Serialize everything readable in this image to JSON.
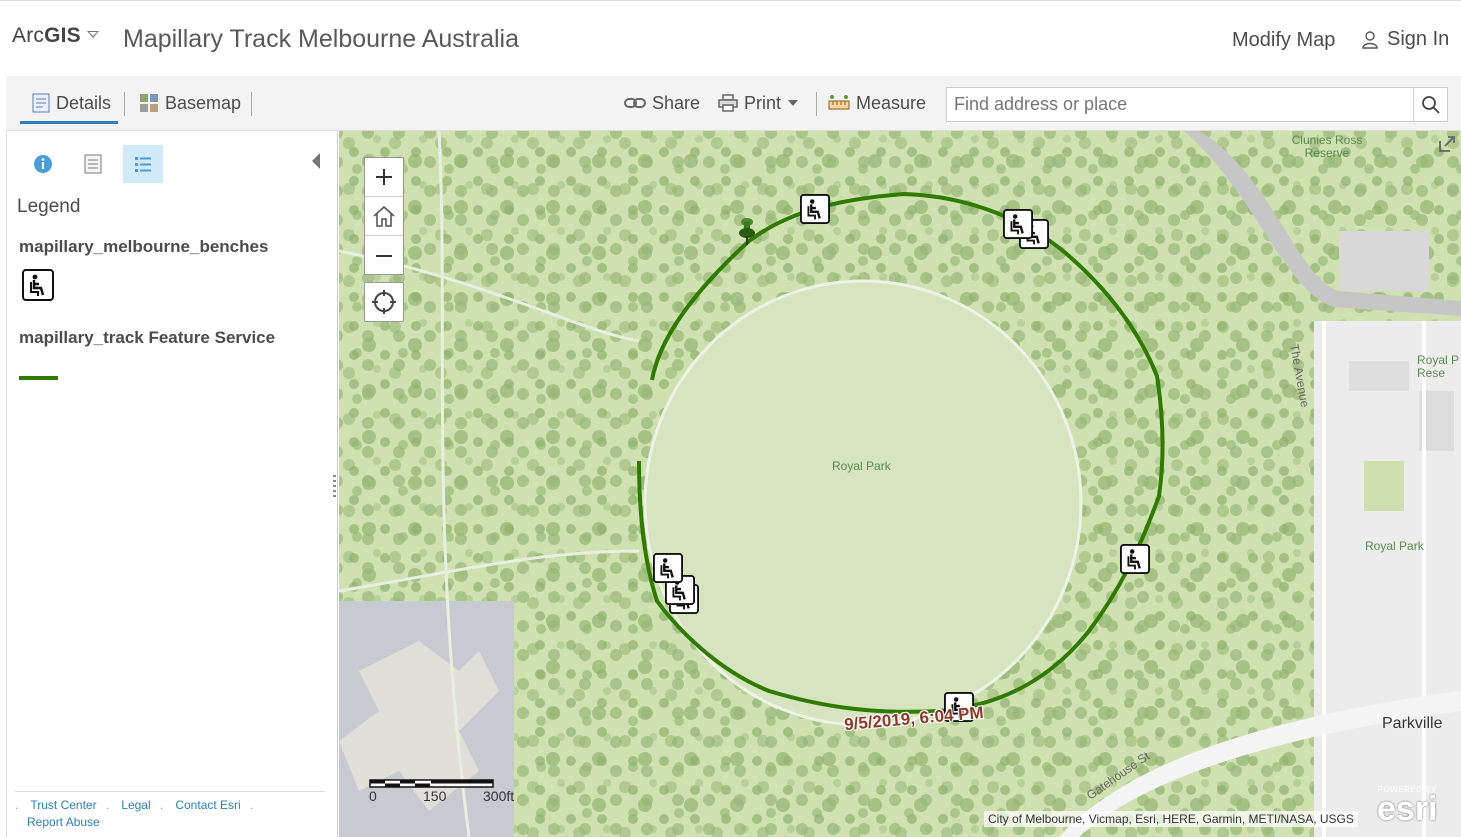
{
  "header": {
    "logo_prefix": "Arc",
    "logo_bold": "GIS",
    "title": "Mapillary Track Melbourne Australia",
    "modify_map": "Modify Map",
    "sign_in": "Sign In"
  },
  "toolbar": {
    "tabs": [
      {
        "label": "Details",
        "icon": "details-icon",
        "active": true
      },
      {
        "label": "Basemap",
        "icon": "basemap-grid-icon",
        "active": false
      }
    ],
    "share": "Share",
    "print": "Print",
    "measure": "Measure",
    "search_placeholder": "Find address or place"
  },
  "panel": {
    "icons": [
      "info-icon",
      "content-icon",
      "legend-list-icon"
    ],
    "active_icon": "legend-list-icon",
    "legend_title": "Legend",
    "layers": [
      {
        "name": "mapillary_melbourne_benches",
        "symbol": "bench-icon"
      },
      {
        "name": "mapillary_track Feature Service",
        "symbol": "line",
        "color": "#2f7a00"
      }
    ],
    "footer_links": [
      "Trust Center",
      "Legal",
      "Contact Esri",
      "Report Abuse"
    ]
  },
  "map": {
    "labels": {
      "royal_park_center": "Royal Park",
      "royal_park_right": "Royal Park",
      "clunies_ross": "Clunies Ross\nReserve",
      "the_avenue": "The Avenue",
      "royal_p_partial": "Royal P\nRese",
      "gatehouse": "Gatehouse St",
      "parkville": "Parkville"
    },
    "timestamp": "9/5/2019, 6:04 PM",
    "scale": {
      "labels": [
        "0",
        "150",
        "300ft"
      ]
    },
    "attribution": "City of Melbourne, Vicmap, Esri, HERE, Garmin, METI/NASA, USGS",
    "esri_powered": "POWERED BY",
    "esri": "esri",
    "track_color": "#2f7a00"
  }
}
